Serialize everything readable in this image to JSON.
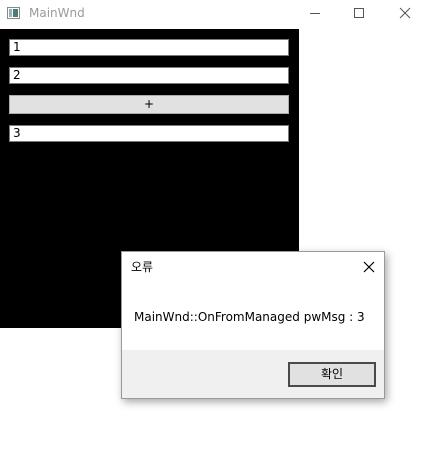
{
  "window": {
    "title": "MainWnd"
  },
  "main": {
    "field1_value": "1",
    "field2_value": "2",
    "add_button_label": "+",
    "result_value": "3"
  },
  "dialog": {
    "title": "오류",
    "message": "MainWnd::OnFromManaged pwMsg : 3",
    "ok_label": "확인"
  },
  "icons": {
    "app": "app-window-icon",
    "minimize": "minimize-icon",
    "maximize": "maximize-icon",
    "close": "close-icon"
  },
  "colors": {
    "client_background": "#000000",
    "title_text": "#9a9a9a",
    "button_face": "#e1e1e1",
    "dialog_footer": "#f0f0f0"
  }
}
